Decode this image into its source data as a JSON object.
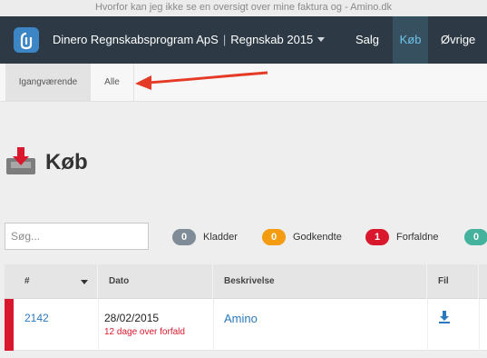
{
  "window": {
    "title": "Hvorfor kan jeg ikke se en oversigt over mine faktura og - Amino.dk"
  },
  "navbar": {
    "company": "Dinero Regnskabsprogram ApS",
    "fiscal_year": "Regnskab 2015",
    "separator": "|",
    "items": [
      {
        "label": "Salg",
        "active": false
      },
      {
        "label": "Køb",
        "active": true
      },
      {
        "label": "Øvrige",
        "active": false
      }
    ]
  },
  "subnav": {
    "tabs": [
      {
        "label": "Igangværende",
        "active": true
      },
      {
        "label": "Alle",
        "active": false
      }
    ]
  },
  "page": {
    "title": "Køb",
    "icon": "inbox-download-icon"
  },
  "search": {
    "placeholder": "Søg...",
    "value": ""
  },
  "filters": [
    {
      "count": "0",
      "label": "Kladder",
      "color": "#7f8c97"
    },
    {
      "count": "0",
      "label": "Godkendte",
      "color": "#f39c12"
    },
    {
      "count": "1",
      "label": "Forfaldne",
      "color": "#d9182d"
    },
    {
      "count": "0",
      "label": "",
      "color": "#45b29d"
    }
  ],
  "table": {
    "columns": [
      "#",
      "Dato",
      "Beskrivelse",
      "Fil"
    ],
    "rows": [
      {
        "number": "2142",
        "date": "28/02/2015",
        "status": "12 dage over forfald",
        "description": "Amino",
        "file_icon": "download-icon"
      }
    ]
  },
  "colors": {
    "nav_bg": "#2d3a45",
    "active_nav": "#6ec3e8",
    "link": "#2b79bd",
    "overdue": "#d9182d",
    "annotation_arrow": "#e53a26"
  }
}
